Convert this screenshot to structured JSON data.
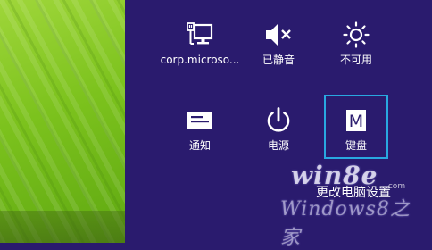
{
  "tiles": [
    {
      "label": "corp.microso...",
      "icon": "network-icon"
    },
    {
      "label": "已静音",
      "icon": "volume-muted-icon"
    },
    {
      "label": "不可用",
      "icon": "brightness-icon"
    },
    {
      "label": "通知",
      "icon": "notifications-icon"
    },
    {
      "label": "电源",
      "icon": "power-icon"
    },
    {
      "label": "键盘",
      "icon": "keyboard-icon",
      "icon_text": "M"
    }
  ],
  "settings_link": "更改电脑设置",
  "watermark": {
    "top": "win8e",
    "dotcom": ".com",
    "bottom": "Windows8之家"
  },
  "colors": {
    "panel": "#2a1b6e",
    "focus_border": "#29a8e0",
    "text": "#ffffff"
  }
}
